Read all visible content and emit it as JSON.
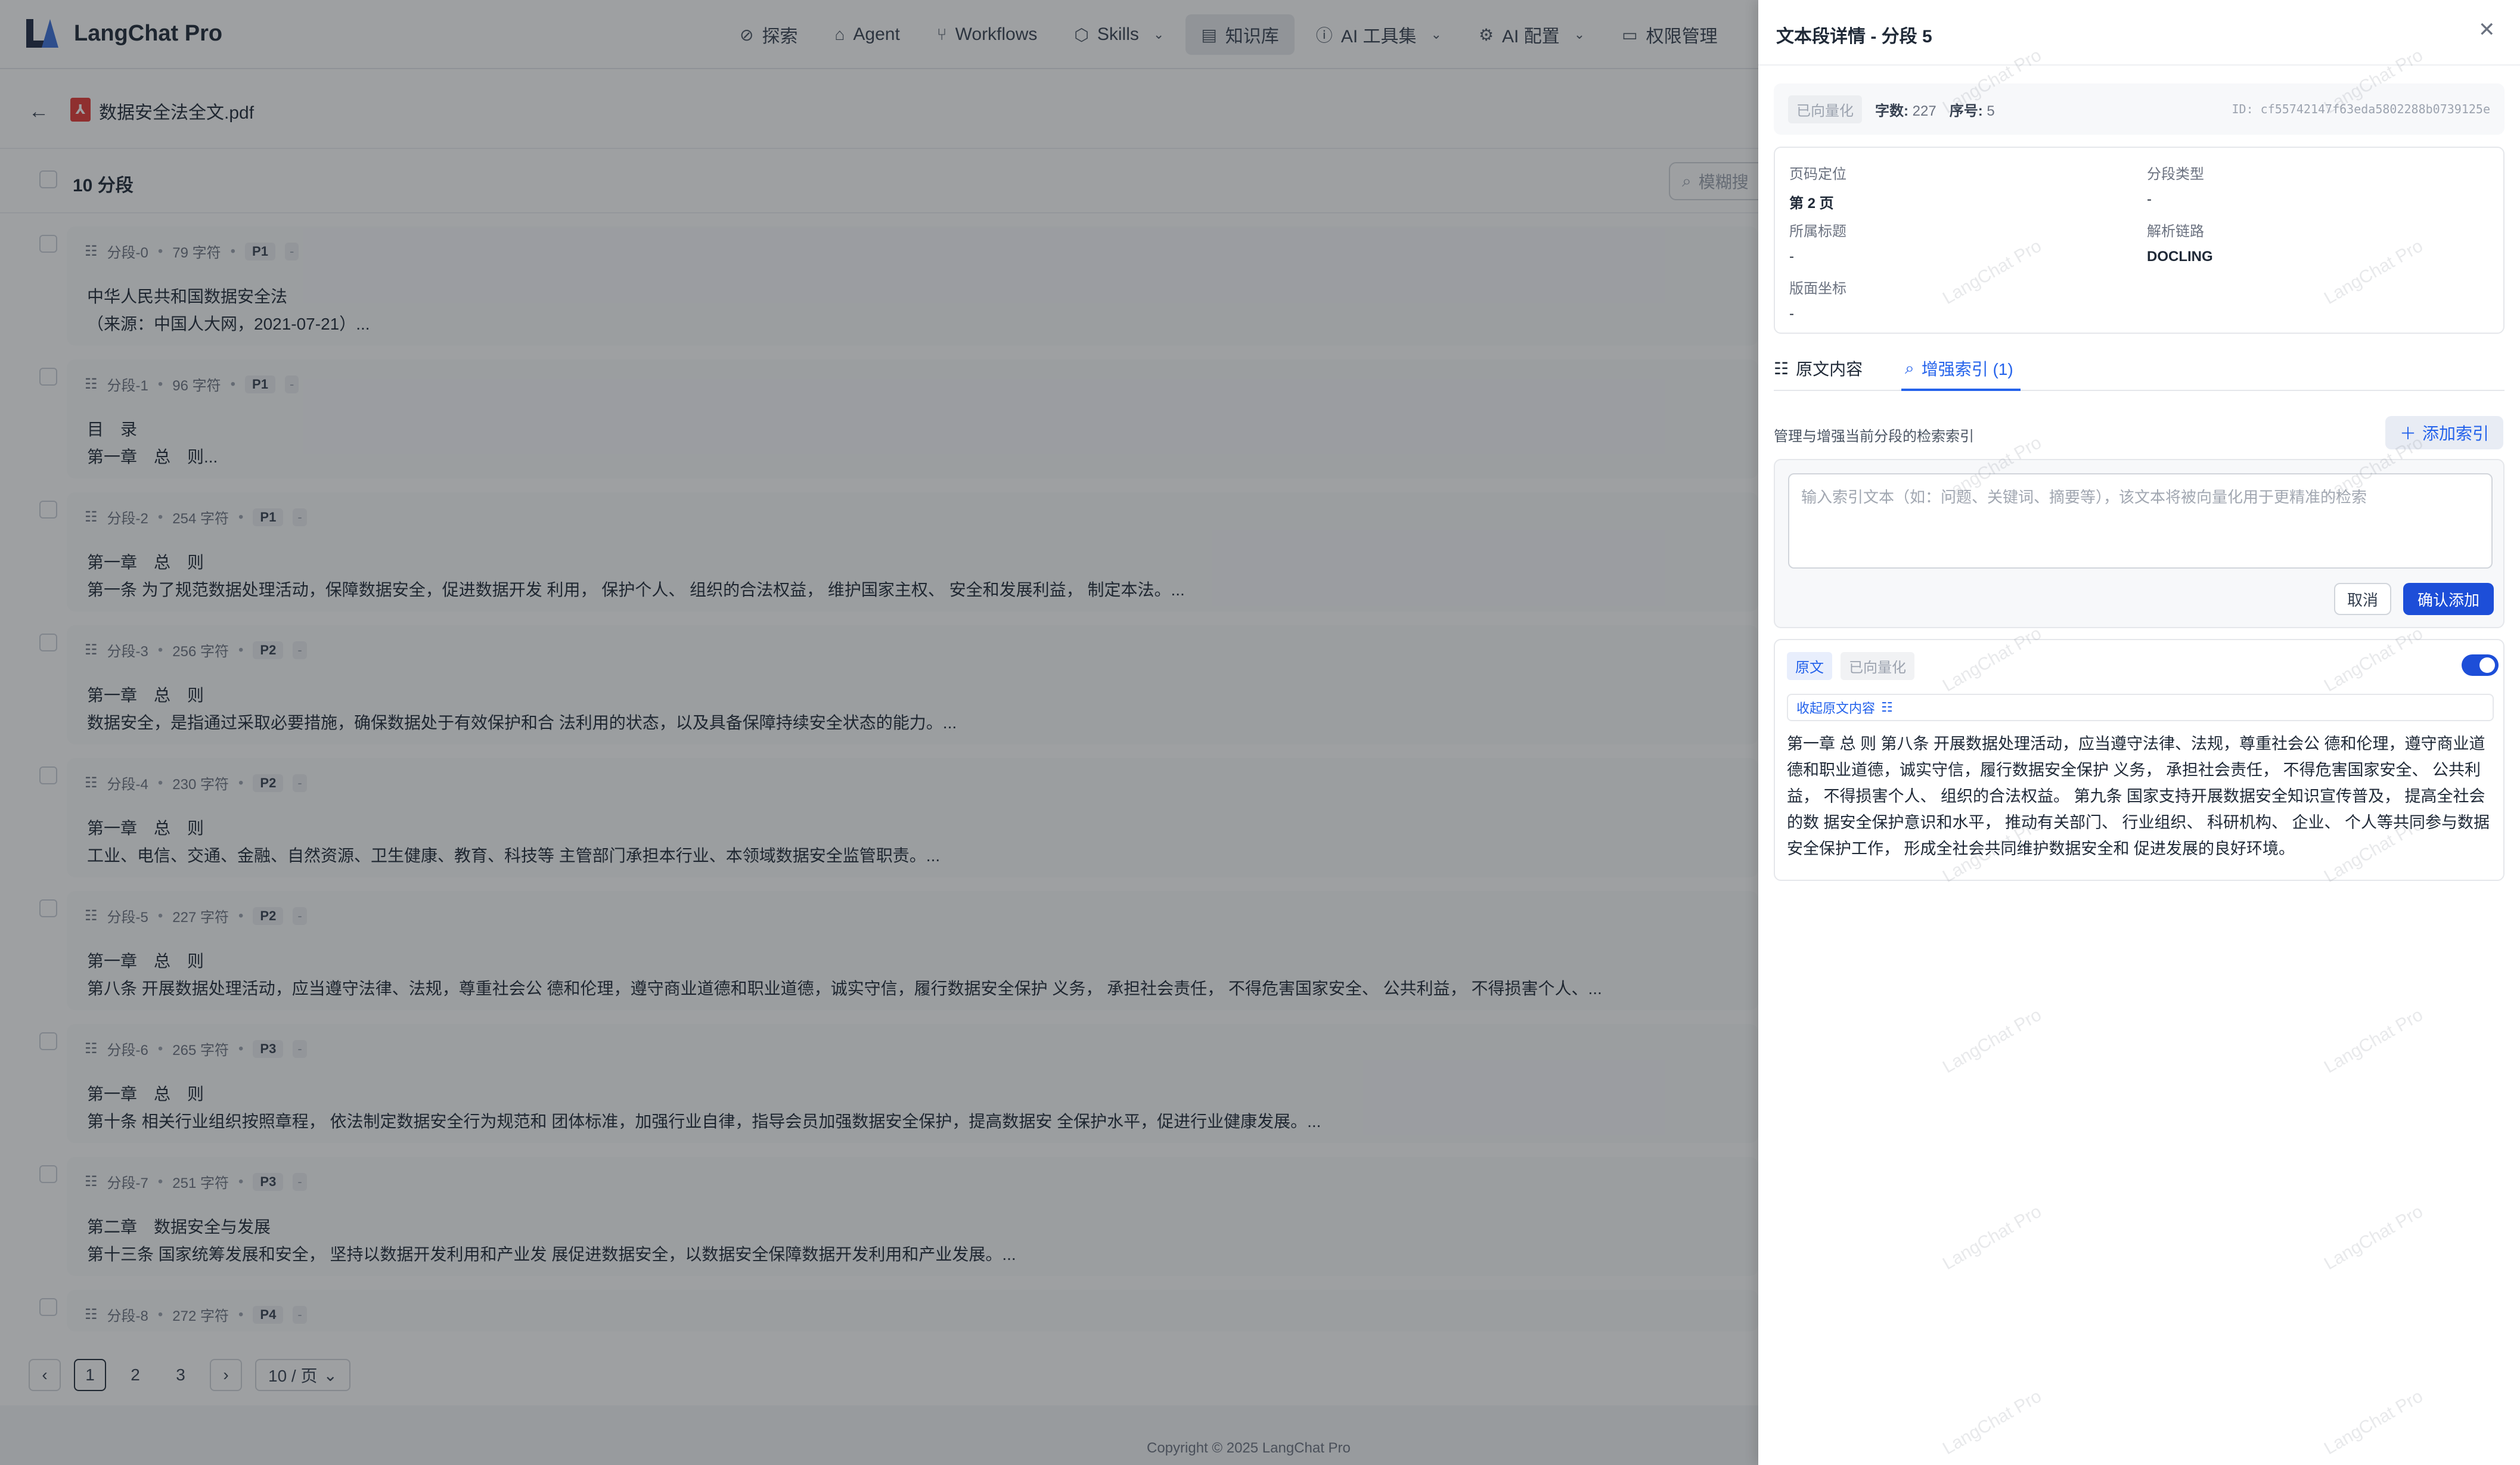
{
  "app": {
    "brand_name": "LangChat Pro",
    "nav": [
      {
        "label": "探索",
        "icon": "compass-icon",
        "active": false,
        "has_menu": false
      },
      {
        "label": "Agent",
        "icon": "robot-icon",
        "active": false,
        "has_menu": false
      },
      {
        "label": "Workflows",
        "icon": "workflow-icon",
        "active": false,
        "has_menu": false
      },
      {
        "label": "Skills",
        "icon": "skills-icon",
        "active": false,
        "has_menu": true
      },
      {
        "label": "知识库",
        "icon": "book-icon",
        "active": true,
        "has_menu": false
      },
      {
        "label": "AI 工具集",
        "icon": "info-icon",
        "active": false,
        "has_menu": true
      },
      {
        "label": "AI 配置",
        "icon": "gear-icon",
        "active": false,
        "has_menu": true
      },
      {
        "label": "权限管理",
        "icon": "folder-lock-icon",
        "active": false,
        "has_menu": false
      }
    ]
  },
  "document": {
    "title": "数据安全法全文.pdf",
    "segment_count_label": "10 分段",
    "search_placeholder": "模糊搜"
  },
  "segments": [
    {
      "name": "分段-0",
      "chars": "79 字符",
      "page": "P1",
      "extra": "-",
      "line1": "中华人民共和国数据安全法",
      "line2": "（来源：中国人大网，2021-07-21）..."
    },
    {
      "name": "分段-1",
      "chars": "96 字符",
      "page": "P1",
      "extra": "-",
      "line1": "目　录",
      "line2": "第一章　总　则..."
    },
    {
      "name": "分段-2",
      "chars": "254 字符",
      "page": "P1",
      "extra": "-",
      "line1": "第一章　总　则",
      "line2": "第一条 为了规范数据处理活动，保障数据安全，促进数据开发 利用， 保护个人、 组织的合法权益， 维护国家主权、 安全和发展利益， 制定本法。..."
    },
    {
      "name": "分段-3",
      "chars": "256 字符",
      "page": "P2",
      "extra": "-",
      "line1": "第一章　总　则",
      "line2": "数据安全，是指通过采取必要措施，确保数据处于有效保护和合 法利用的状态，以及具备保障持续安全状态的能力。..."
    },
    {
      "name": "分段-4",
      "chars": "230 字符",
      "page": "P2",
      "extra": "-",
      "line1": "第一章　总　则",
      "line2": "工业、电信、交通、金融、自然资源、卫生健康、教育、科技等 主管部门承担本行业、本领域数据安全监管职责。..."
    },
    {
      "name": "分段-5",
      "chars": "227 字符",
      "page": "P2",
      "extra": "-",
      "line1": "第一章　总　则",
      "line2": "第八条 开展数据处理活动，应当遵守法律、法规，尊重社会公 德和伦理，遵守商业道德和职业道德，诚实守信，履行数据安全保护 义务， 承担社会责任， 不得危害国家安全、 公共利益， 不得损害个人、..."
    },
    {
      "name": "分段-6",
      "chars": "265 字符",
      "page": "P3",
      "extra": "-",
      "line1": "第一章　总　则",
      "line2": "第十条 相关行业组织按照章程， 依法制定数据安全行为规范和 团体标准，加强行业自律，指导会员加强数据安全保护，提高数据安 全保护水平，促进行业健康发展。..."
    },
    {
      "name": "分段-7",
      "chars": "251 字符",
      "page": "P3",
      "extra": "-",
      "line1": "第二章　数据安全与发展",
      "line2": "第十三条 国家统筹发展和安全， 坚持以数据开发利用和产业发 展促进数据安全，以数据安全保障数据开发利用和产业发展。..."
    },
    {
      "name": "分段-8",
      "chars": "272 字符",
      "page": "P4",
      "extra": "-",
      "line1": "",
      "line2": ""
    }
  ],
  "pagination": {
    "prev": "‹",
    "pages": [
      "1",
      "2",
      "3"
    ],
    "current": "1",
    "next": "›",
    "page_size": "10 / 页"
  },
  "footer": {
    "copyright": "Copyright © 2025 LangChat Pro"
  },
  "drawer": {
    "title": "文本段详情 - 分段 5",
    "status_badge": "已向量化",
    "chars_label": "字数:",
    "chars_value": "227",
    "order_label": "序号:",
    "order_value": "5",
    "id_text": "ID: cf55742147f63eda5802288b0739125e",
    "meta": {
      "page_label": "页码定位",
      "page_value": "第 2 页",
      "type_label": "分段类型",
      "type_value": "-",
      "heading_label": "所属标题",
      "heading_value": "-",
      "parser_label": "解析链路",
      "parser_value": "DOCLING",
      "coord_label": "版面坐标",
      "coord_value": "-"
    },
    "tabs": {
      "original": "原文内容",
      "enhanced": "增强索引 (1)"
    },
    "index_desc": "管理与增强当前分段的检索索引",
    "add_index": "添加索引",
    "index_placeholder": "输入索引文本（如：问题、关键词、摘要等），该文本将被向量化用于更精准的检索",
    "cancel": "取消",
    "confirm": "确认添加",
    "orig_tag": "原文",
    "vector_tag": "已向量化",
    "toggle_on": true,
    "collapse_label": "收起原文内容",
    "original_text": "第一章 总 则 第八条 开展数据处理活动，应当遵守法律、法规，尊重社会公 德和伦理，遵守商业道德和职业道德，诚实守信，履行数据安全保护 义务， 承担社会责任， 不得危害国家安全、 公共利益， 不得损害个人、 组织的合法权益。 第九条 国家支持开展数据安全知识宣传普及， 提高全社会的数 据安全保护意识和水平， 推动有关部门、 行业组织、 科研机构、 企业、 个人等共同参与数据安全保护工作， 形成全社会共同维护数据安全和 促进发展的良好环境。"
  },
  "watermark": "LangChat Pro",
  "colors": {
    "primary": "#1d4ed8",
    "accent_blue": "#2563eb",
    "text": "#1f2937",
    "muted": "#6b7280"
  }
}
